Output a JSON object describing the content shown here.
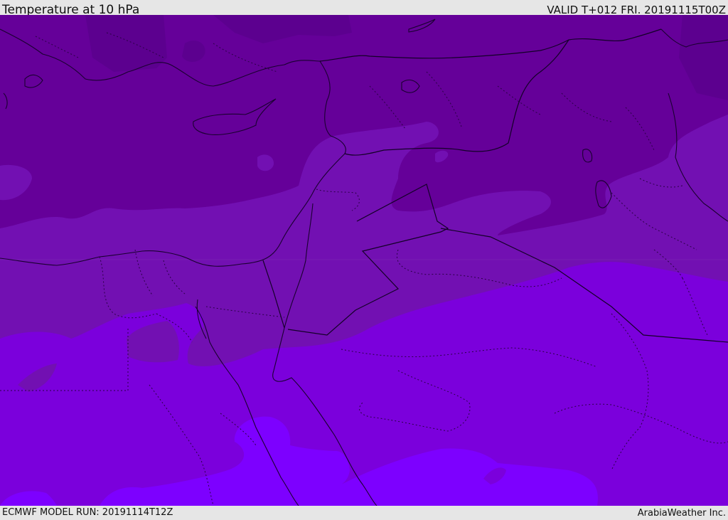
{
  "header": {
    "title": "Temperature at 10 hPa",
    "valid": "VALID T+012 FRI. 20191115T00Z"
  },
  "footer": {
    "model_run": "ECMWF MODEL RUN: 20191114T12Z",
    "credit": "ArabiaWeather Inc."
  },
  "map": {
    "field": "temperature",
    "level": "10 hPa",
    "region": "Eastern Mediterranean / Middle East",
    "colors": {
      "band_dark": "#650099",
      "band_darkest": "#5c008f",
      "band_mid": "#7210b2",
      "band_light": "#7b00dc",
      "band_lightest": "#7d00ff"
    }
  }
}
